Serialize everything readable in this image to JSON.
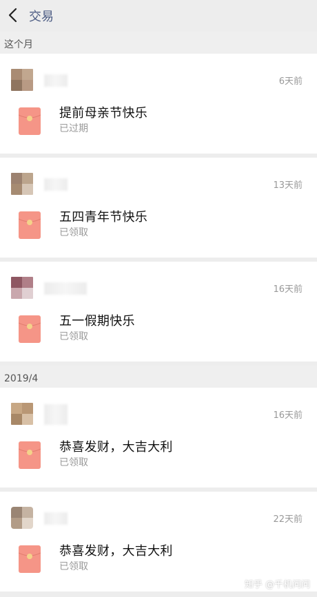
{
  "header": {
    "title": "交易"
  },
  "sections": [
    {
      "label": "这个月",
      "items": [
        {
          "time": "6天前",
          "title": "提前母亲节快乐",
          "status": "已过期"
        },
        {
          "time": "13天前",
          "title": "五四青年节快乐",
          "status": "已领取"
        },
        {
          "time": "16天前",
          "title": "五一假期快乐",
          "status": "已领取"
        }
      ]
    },
    {
      "label": "2019/4",
      "items": [
        {
          "time": "16天前",
          "title": "恭喜发财，大吉大利",
          "status": "已领取"
        },
        {
          "time": "22天前",
          "title": "恭喜发财，大吉大利",
          "status": "已领取"
        }
      ]
    }
  ],
  "watermark": "知乎 @千机问问",
  "colors": {
    "envelope": "#f59587",
    "seal": "#f4d28a",
    "title": "#4b5b83"
  }
}
